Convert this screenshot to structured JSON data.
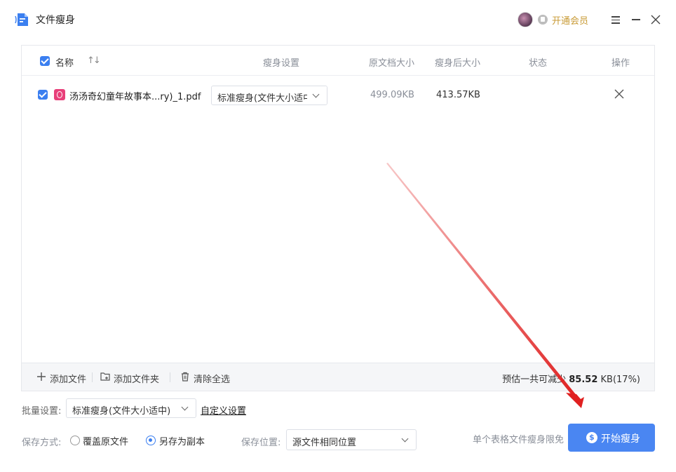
{
  "app": {
    "title": "文件瘦身",
    "vip_label": "开通会员"
  },
  "table": {
    "headers": {
      "name": "名称",
      "slim_settings": "瘦身设置",
      "original_size": "原文档大小",
      "slimmed_size": "瘦身后大小",
      "status": "状态",
      "actions": "操作"
    },
    "rows": [
      {
        "checked": true,
        "file_name": "汤汤奇幻童年故事本...ry)_1.pdf",
        "slim_mode": "标准瘦身(文件大小适中)",
        "original_size": "499.09KB",
        "slimmed_size": "413.57KB",
        "status": ""
      }
    ],
    "footer": {
      "add_file": "添加文件",
      "add_folder": "添加文件夹",
      "clear_all": "清除全选",
      "estimate_prefix": "预估一共可减少",
      "estimate_value": "85.52",
      "estimate_suffix": "KB(17%)"
    }
  },
  "settings": {
    "batch_label": "批量设置:",
    "batch_value": "标准瘦身(文件大小适中)",
    "custom_link": "自定义设置",
    "save_method_label": "保存方式:",
    "overwrite_label": "覆盖原文件",
    "save_copy_label": "另存为副本",
    "save_method_selected": "另存为副本",
    "save_location_label": "保存位置:",
    "save_location_value": "源文件相同位置",
    "limit_note": "单个表格文件瘦身限免"
  },
  "start_button": "开始瘦身",
  "colors": {
    "accent": "#4a86f2",
    "vip": "#c89a35",
    "annotation_arrow": "#e02020"
  }
}
